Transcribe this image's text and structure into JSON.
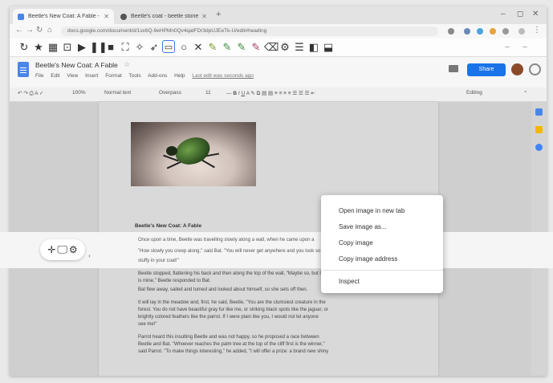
{
  "browser": {
    "tabs": [
      {
        "title": "Beetle's New Coat: A Fable - Goo",
        "active": true,
        "favicon_color": "#4a86e8"
      },
      {
        "title": "Beetle's coat - beetle stories - La",
        "active": false,
        "favicon_color": "#555555"
      }
    ],
    "url": "docs.google.com/document/d/1sx6Q-9eHPMn0Qv4qatFDr3dpUJEeTk-U/edit#heading"
  },
  "doc": {
    "title": "Beetle's New Coat: A Fable",
    "menu": [
      "File",
      "Edit",
      "View",
      "Insert",
      "Format",
      "Tools",
      "Add-ons",
      "Help"
    ],
    "last_edit": "Last edit was seconds ago",
    "share_label": "Share",
    "toolbar": {
      "zoom": "100%",
      "style": "Normal text",
      "font": "Overpass",
      "size": "11",
      "mode": "Editing"
    },
    "heading": "Beetle's New Coat: A Fable",
    "paragraphs": [
      "Once upon a time, Beetle was travelling slowly along a wall, when he came upon a",
      "\"How slowly you creep along,\" said Bat. \"You will never get anywhere and you look so",
      "stuffy in your coat!\"",
      "Beetle stopped, flattening his back and then along the top of the wall, \"Maybe so, but I",
      "is mine,\" Beetle responded to Bat.",
      "Bat flew away, sailed and turned and looked about himself, so she sets off then.",
      "It will lay in the meadow and, first, he said, Beetle, \"You are the clumsiest creature in the",
      "forest. You do not have beautiful gray fur like me, or striking black spots like the jaguar, or",
      "brightly colored feathers like the parrot. If I were plain like you, I would not let anyone",
      "see me!\"",
      "Parrot heard this insulting Beetle and was not happy, so he proposed a race between",
      "Beetle and Bat. \"Whoever reaches the palm tree at the top of the cliff first is the winner,\"",
      "said Parrot. \"To make things interesting,\" he added, \"I will offer a prize: a brand new shiny"
    ]
  },
  "context_menu": {
    "items": [
      "Open image in new tab",
      "Save image as...",
      "Copy image",
      "Copy image address",
      "Inspect"
    ]
  },
  "colors": {
    "accent": "#1a73e8",
    "doc_icon": "#4a86e8"
  },
  "icons": [
    "reload-icon",
    "star-icon",
    "grid-icon",
    "caption-icon",
    "play-icon",
    "pause-icon",
    "stop-icon",
    "crop-icon",
    "pin-icon",
    "screen-icon",
    "circle-icon",
    "shuffle-icon",
    "pen-icon",
    "highlighter-icon",
    "marker-icon",
    "brush-icon",
    "eraser-icon",
    "settings-icon",
    "list-icon",
    "save-icon",
    "export-icon",
    "move-icon",
    "monitor-icon",
    "gear-icon"
  ]
}
